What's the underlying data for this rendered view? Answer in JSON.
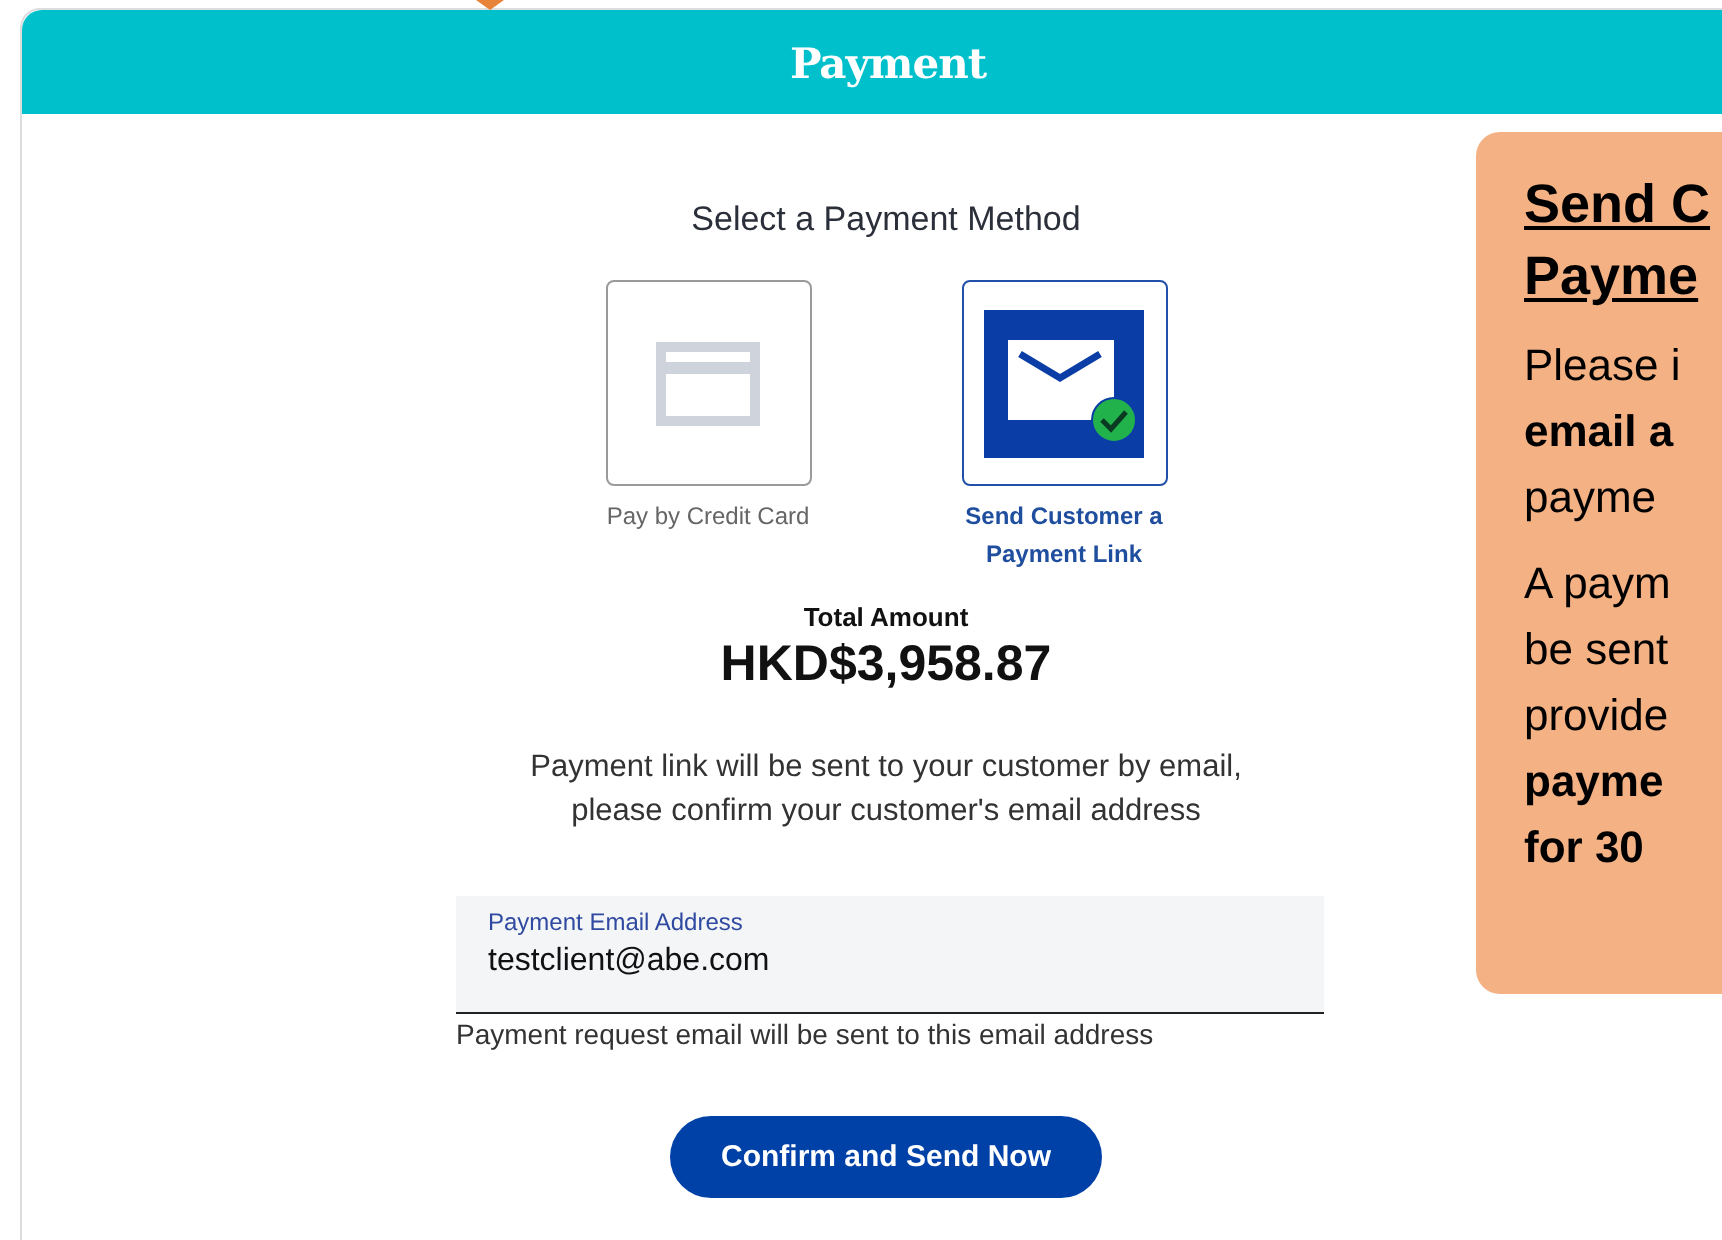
{
  "modal": {
    "title": "Payment"
  },
  "method_heading": "Select a Payment Method",
  "methods": [
    {
      "label": "Pay by Credit Card",
      "kind": "card",
      "selected": false
    },
    {
      "label": "Send Customer a Payment Link",
      "kind": "email",
      "selected": true
    }
  ],
  "total": {
    "label": "Total Amount",
    "amount": "HKD$3,958.87"
  },
  "instruction": "Payment link will be sent to your customer by email, please confirm your customer's email address",
  "email_field": {
    "label": "Payment Email Address",
    "value": "testclient@abe.com",
    "helper": "Payment request email will be sent to this email address"
  },
  "confirm_button": "Confirm and Send Now",
  "callout": {
    "heading": [
      "Send C",
      "Payme"
    ],
    "paragraphs": [
      [
        {
          "text": "Please i",
          "bold": false
        },
        {
          "text": "email a",
          "bold": true
        },
        {
          "text": "payme",
          "bold": false
        }
      ],
      [
        {
          "text": "A paym",
          "bold": false
        },
        {
          "text": "be sent",
          "bold": false
        },
        {
          "text": "provide",
          "bold": false
        },
        {
          "text": "payme",
          "bold": true
        },
        {
          "text": "for 30",
          "bold": true
        }
      ]
    ]
  }
}
